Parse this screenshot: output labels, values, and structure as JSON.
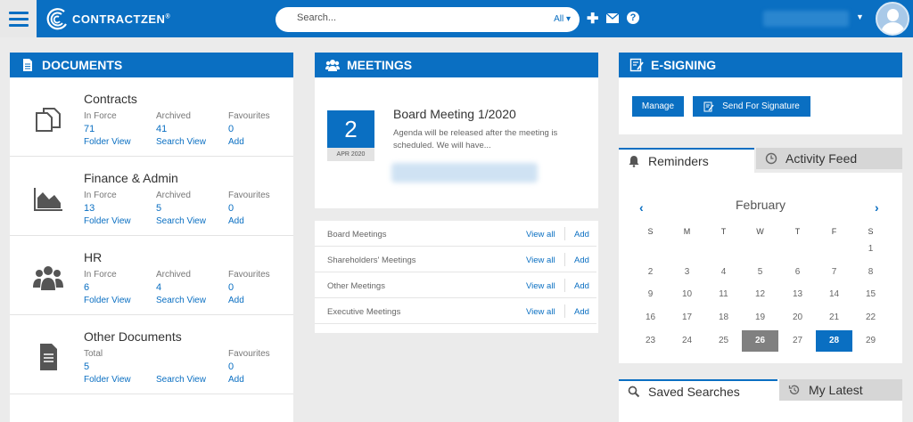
{
  "app": {
    "logo_text": "CONTRACT",
    "logo_text_bold": "ZEN",
    "logo_mark": "®"
  },
  "search": {
    "placeholder": "Search...",
    "scope": "All"
  },
  "topbar": {
    "icons": [
      "plus-icon",
      "mail-icon",
      "help-icon"
    ],
    "help_glyph": "?"
  },
  "documents": {
    "title": "DOCUMENTS",
    "rows": [
      {
        "title": "Contracts",
        "icon": "copy-icon",
        "col1_label": "In Force",
        "col1_value": "71",
        "col1_link": "Folder View",
        "col2_label": "Archived",
        "col2_value": "41",
        "col2_link": "Search View",
        "col3_label": "Favourites",
        "col3_value": "0",
        "col3_link": "Add"
      },
      {
        "title": "Finance & Admin",
        "icon": "area-chart-icon",
        "col1_label": "In Force",
        "col1_value": "13",
        "col1_link": "Folder View",
        "col2_label": "Archived",
        "col2_value": "5",
        "col2_link": "Search View",
        "col3_label": "Favourites",
        "col3_value": "0",
        "col3_link": "Add"
      },
      {
        "title": "HR",
        "icon": "users-icon",
        "col1_label": "In Force",
        "col1_value": "6",
        "col1_link": "Folder View",
        "col2_label": "Archived",
        "col2_value": "4",
        "col2_link": "Search View",
        "col3_label": "Favourites",
        "col3_value": "0",
        "col3_link": "Add"
      },
      {
        "title": "Other Documents",
        "icon": "file-text-icon",
        "col1_label": "Total",
        "col1_value": "5",
        "col1_link": "Folder View",
        "col2_label": "",
        "col2_value": "",
        "col2_link": "Search View",
        "col3_label": "Favourites",
        "col3_value": "0",
        "col3_link": "Add"
      }
    ]
  },
  "meetings": {
    "title": "MEETINGS",
    "next": {
      "day": "2",
      "month": "APR 2020",
      "title": "Board Meeting 1/2020",
      "description": "Agenda will be released after the meeting is scheduled. We will have..."
    },
    "categories": [
      {
        "name": "Board Meetings",
        "view_all": "View all",
        "add": "Add"
      },
      {
        "name": "Shareholders' Meetings",
        "view_all": "View all",
        "add": "Add"
      },
      {
        "name": "Other Meetings",
        "view_all": "View all",
        "add": "Add"
      },
      {
        "name": "Executive Meetings",
        "view_all": "View all",
        "add": "Add"
      }
    ]
  },
  "esigning": {
    "title": "E-SIGNING",
    "manage_label": "Manage",
    "send_label": "Send For Signature"
  },
  "reminders_tabs": {
    "active": "Reminders",
    "inactive": "Activity Feed"
  },
  "calendar": {
    "month": "February",
    "prev": "‹",
    "next": "›",
    "weekdays": [
      "S",
      "M",
      "T",
      "W",
      "T",
      "F",
      "S"
    ],
    "weeks": [
      [
        "",
        "",
        "",
        "",
        "",
        "",
        "1"
      ],
      [
        "2",
        "3",
        "4",
        "5",
        "6",
        "7",
        "8"
      ],
      [
        "9",
        "10",
        "11",
        "12",
        "13",
        "14",
        "15"
      ],
      [
        "16",
        "17",
        "18",
        "19",
        "20",
        "21",
        "22"
      ],
      [
        "23",
        "24",
        "25",
        "26",
        "27",
        "28",
        "29"
      ]
    ],
    "today": "26",
    "selected": "28"
  },
  "bottom_tabs": {
    "active": "Saved Searches",
    "inactive": "My Latest"
  },
  "colors": {
    "brand": "#0a6fc2",
    "background": "#ebebeb",
    "today": "#808080"
  }
}
